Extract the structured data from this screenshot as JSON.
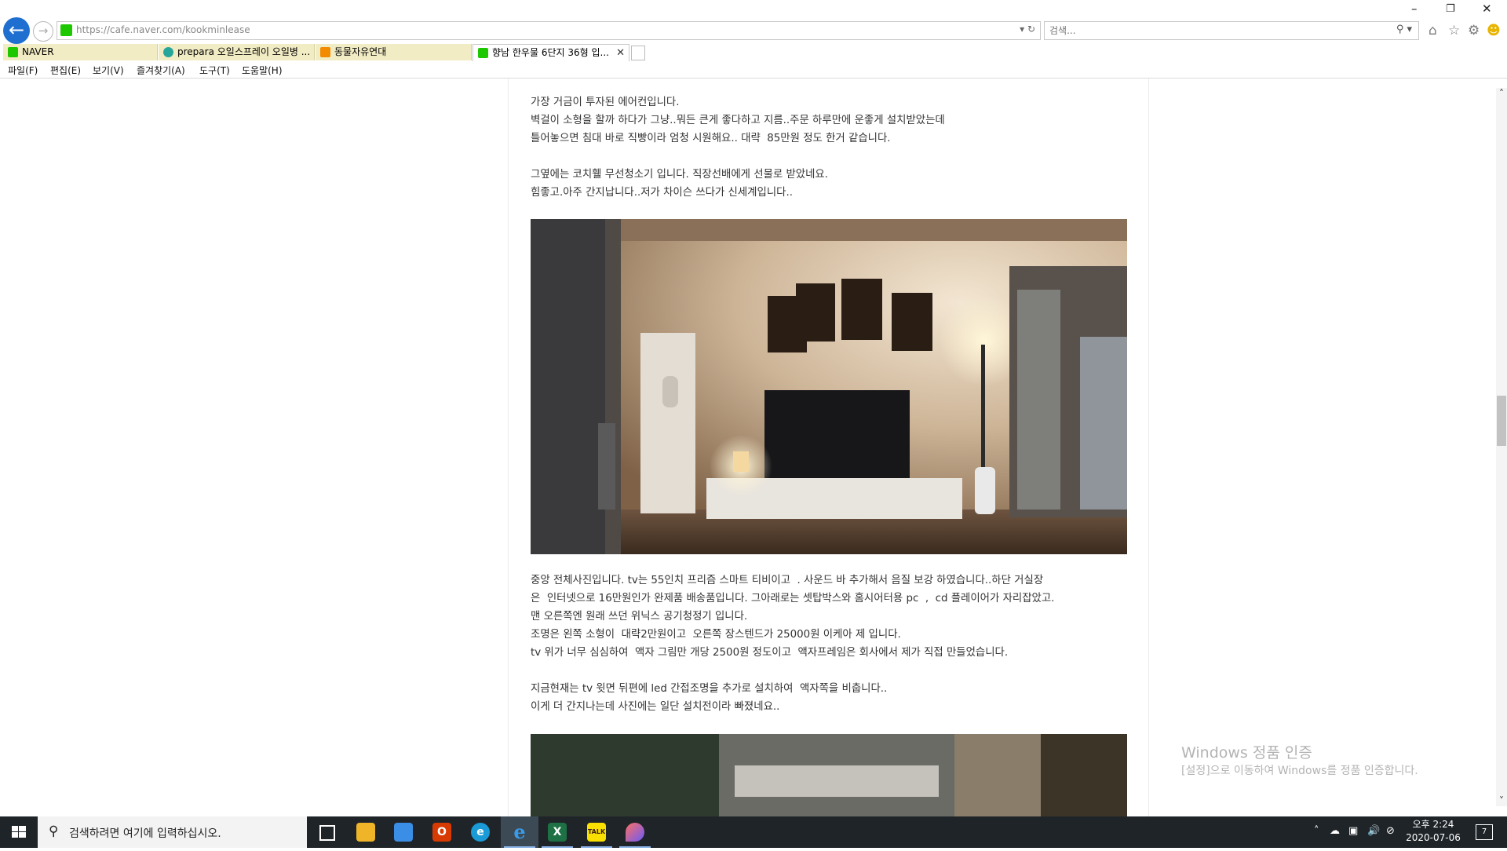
{
  "browser": {
    "url": "https://cafe.naver.com/kookminlease",
    "search_placeholder": "검색...",
    "tabs": [
      {
        "label": "NAVER",
        "icon": "naver-icon",
        "color": "#1ec800",
        "active": false
      },
      {
        "label": "prepara 오일스프레이 오일병 ...",
        "icon": "shop-icon",
        "color": "#26a69a",
        "active": false
      },
      {
        "label": "동물자유연대",
        "icon": "animal-icon",
        "color": "#f28b00",
        "active": false
      },
      {
        "label": "향남 한우물 6단지 36형 입...",
        "icon": "cafe-icon",
        "color": "#1ec800",
        "active": true
      }
    ],
    "menu": [
      "파일(F)",
      "편집(E)",
      "보기(V)",
      "즐겨찾기(A)",
      "도구(T)",
      "도움말(H)"
    ]
  },
  "post": {
    "para1": "가장 거금이 투자된 에어컨입니다.\n벽걸이 소형을 할까 하다가 그냥..뭐든 큰게 좋다하고 지름..주문 하루만에 운좋게 설치받았는데\n틀어놓으면 침대 바로 직빵이라 엄청 시원해요.. 대략  85만원 정도 한거 같습니다.",
    "para2": "그옆에는 코치휄 무선청소기 입니다. 직장선배에게 선물로 받았네요.\n힘좋고.아주 간지납니다..저가 차이슨 쓰다가 신세계입니다..",
    "para3": "중앙 전체사진입니다. tv는 55인치 프리즘 스마트 티비이고  . 사운드 바 추가해서 음질 보강 하였습니다..하단 거실장\n은  인터넷으로 16만원인가 완제품 배송품입니다. 그아래로는 셋탑박스와 홈시어터용 pc  ,  cd 플레이어가 자리잡았고.\n맨 오른쪽엔 원래 쓰던 위닉스 공기청정기 입니다.\n조명은 왼쪽 소형이  대략2만원이고  오른쪽 장스텐드가 25000원 이케아 제 입니다.\ntv 위가 너무 심심하여  액자 그림만 개당 2500원 정도이고  액자프레임은 회사에서 제가 직접 만들었습니다.",
    "para4": "지금현재는 tv 윗면 뒤편에 led 간접조명을 추가로 설치하여  액자쪽을 비춥니다..\n이게 더 간지나는데 사진에는 일단 설치전이라 빠졌네요.."
  },
  "watermark": {
    "title": "Windows 정품 인증",
    "subtitle": "[설정]으로 이동하여 Windows를 정품 인증합니다."
  },
  "taskbar": {
    "search_placeholder": "검색하려면 여기에 입력하십시오.",
    "apps": [
      {
        "name": "task-view-icon",
        "glyph": "▯",
        "color": "#1f2428"
      },
      {
        "name": "file-explorer-icon",
        "glyph": "▬",
        "color": "#f0b429"
      },
      {
        "name": "store-icon",
        "glyph": "▣",
        "color": "#3a8ee6"
      },
      {
        "name": "office-icon",
        "glyph": "O",
        "color": "#d83b01"
      },
      {
        "name": "edge-icon",
        "glyph": "e",
        "color": "#1a9bd7"
      },
      {
        "name": "ie-icon",
        "glyph": "e",
        "color": "#2b78d6"
      },
      {
        "name": "excel-icon",
        "glyph": "X",
        "color": "#1e7145"
      },
      {
        "name": "kakaotalk-icon",
        "glyph": "TALK",
        "color": "#f9e000"
      },
      {
        "name": "paint-icon",
        "glyph": "◆",
        "color": "#b455d8"
      }
    ],
    "time": "오후 2:24",
    "date": "2020-07-06",
    "notification_count": "7"
  }
}
